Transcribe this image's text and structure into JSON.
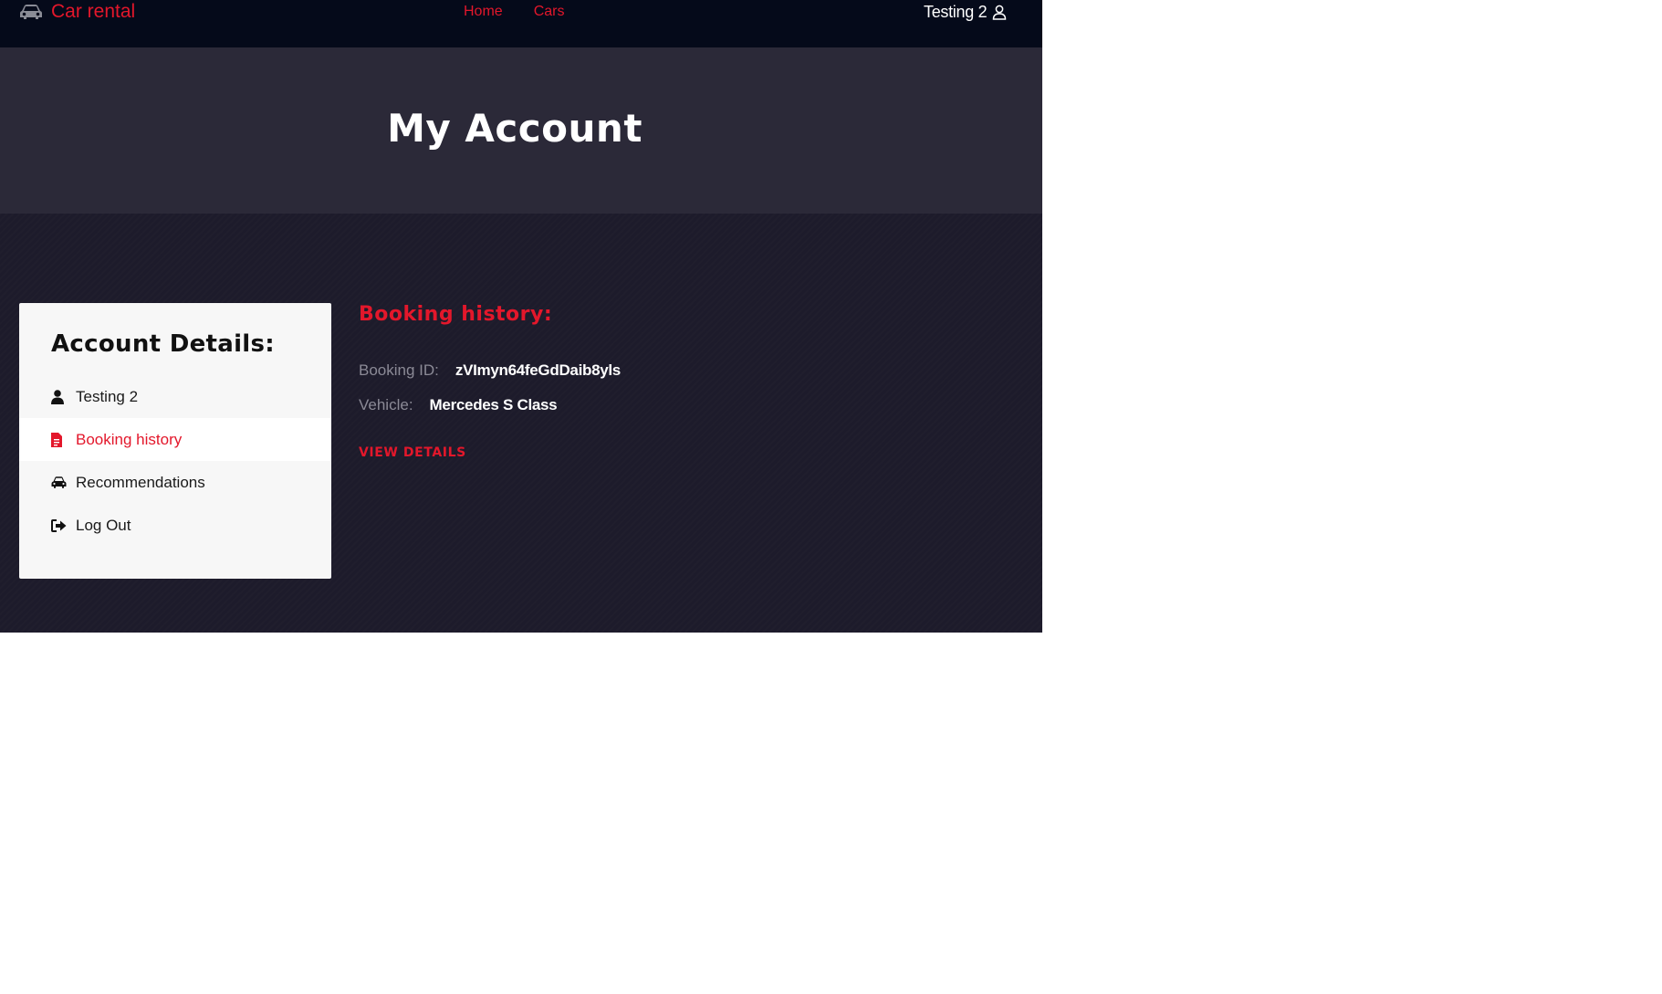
{
  "navbar": {
    "brand_label": "Car rental",
    "brand_icon": "car-icon",
    "links": [
      "Home",
      "Cars"
    ],
    "user_name": "Testing 2",
    "user_icon": "user-icon"
  },
  "hero": {
    "title": "My Account"
  },
  "sidebar": {
    "title": "Account Details:",
    "items": [
      {
        "label": "Testing 2",
        "icon": "user-icon"
      },
      {
        "label": "Booking history",
        "icon": "file-icon"
      },
      {
        "label": "Recommendations",
        "icon": "car-icon"
      },
      {
        "label": "Log Out",
        "icon": "sign-out-icon"
      }
    ]
  },
  "booking_history": {
    "title": "Booking history:",
    "booking_id_label": "Booking ID:",
    "booking_id_value": "zVImyn64feGdDaib8yls",
    "vehicle_label": "Vehicle:",
    "vehicle_value": "Mercedes S Class",
    "view_details_label": "VIEW DETAILS"
  },
  "colors": {
    "accent": "#e3172b",
    "navbar_bg": "#050a1a",
    "hero_bg": "#2b2938",
    "page_bg": "#1d1b2b",
    "card_bg": "#f7f7f7"
  }
}
